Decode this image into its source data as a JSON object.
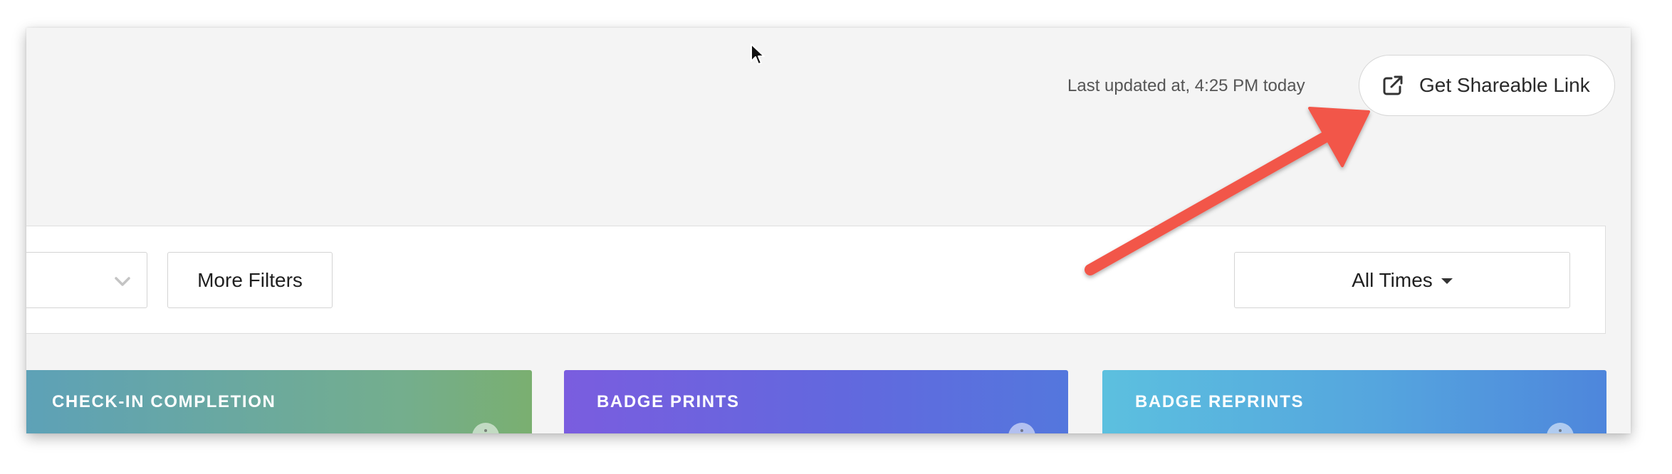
{
  "header": {
    "last_updated": "Last updated at, 4:25 PM today",
    "share_button_label": "Get Shareable Link",
    "share_icon": "external-link-icon"
  },
  "filters": {
    "select_icon": "chevron-down-icon",
    "more_filters_label": "More Filters",
    "time_range_label": "All Times",
    "time_range_icon": "caret-down-icon"
  },
  "cards": [
    {
      "title": "CHECK-IN COMPLETION",
      "gradient": [
        "#5da1b8",
        "#7aaf70"
      ]
    },
    {
      "title": "BADGE PRINTS",
      "gradient": [
        "#7a5ddf",
        "#5477dd"
      ]
    },
    {
      "title": "BADGE REPRINTS",
      "gradient": [
        "#5cc0df",
        "#4e86dc"
      ]
    }
  ],
  "annotation": {
    "arrow_color": "#f2564a",
    "arrow_icon": "annotation-arrow-icon"
  },
  "colors": {
    "page_background": "#f4f4f4",
    "panel_background": "#ffffff",
    "border": "#d4d4d4"
  }
}
